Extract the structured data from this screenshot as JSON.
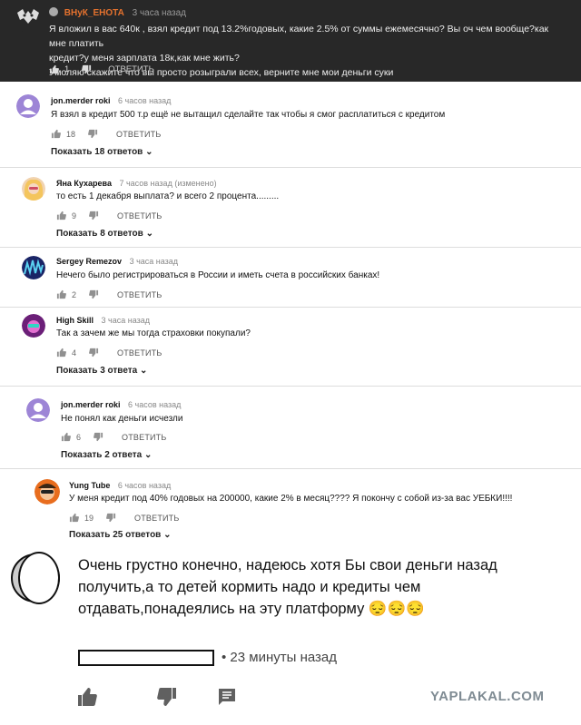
{
  "top_comment": {
    "author": "ВНуК_ЕНОТА",
    "time": "3 часа назад",
    "lines": [
      "Я вложил в вас 640к , взял кредит под 13.2%годовых, какие 2.5% от суммы ежемесячно? Вы оч чем вообще?как мне платить",
      "кредит?у меня зарплата 18к,как мне жить?",
      "Умоляю скажите что вы просто розыграли всех, верните мне мои деньги суки"
    ],
    "likes": "1",
    "reply_label": "ОТВЕТИТЬ"
  },
  "comments": [
    {
      "author": "jon.merder roki",
      "time": "6 часов назад",
      "text": "Я взял в кредит 500 т.р ещё не вытащил сделайте так чтобы я смог расплатиться с кредитом",
      "likes": "18",
      "reply_label": "ОТВЕТИТЬ",
      "more": "Показать 18 ответов"
    },
    {
      "author": "Яна Кухарева",
      "time": "7 часов назад (изменено)",
      "text": "то есть 1 декабря выплата? и всего 2 процента.........",
      "likes": "9",
      "reply_label": "ОТВЕТИТЬ",
      "more": "Показать 8 ответов"
    },
    {
      "author": "Sergey Remezov",
      "time": "3 часа назад",
      "text": "Нечего было регистрироваться в России и иметь счета в российских банках!",
      "likes": "2",
      "reply_label": "ОТВЕТИТЬ",
      "more": ""
    },
    {
      "author": "High Skill",
      "time": "3 часа назад",
      "text": "Так а зачем же мы тогда страховки покупали?",
      "likes": "4",
      "reply_label": "ОТВЕТИТЬ",
      "more": "Показать 3 ответа"
    },
    {
      "author": "jon.merder roki",
      "time": "6 часов назад",
      "text": "Не понял как деньги исчезли",
      "likes": "6",
      "reply_label": "ОТВЕТИТЬ",
      "more": "Показать 2 ответа"
    },
    {
      "author": "Yung Tube",
      "time": "6 часов назад",
      "text": "У меня кредит под 40% годовых на 200000, какие 2% в месяц???? Я покончу с собой из-за вас УЕБКИ!!!!",
      "likes": "19",
      "reply_label": "ОТВЕТИТЬ",
      "more": "Показать 25 ответов"
    }
  ],
  "bottom_comment": {
    "text": "Очень грустно конечно, надеюсь хотя Бы свои деньги назад получить,а то детей кормить надо и кредиты чем отдавать,понадеялись на эту платформу 😔😔😔",
    "time": "• 23 минуты назад"
  },
  "watermark": "YAPLAKAL.COM"
}
